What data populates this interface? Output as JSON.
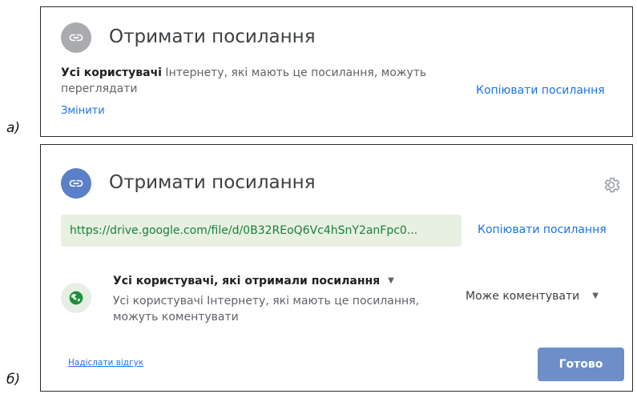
{
  "labels": {
    "a": "a)",
    "b": "б)"
  },
  "panel_a": {
    "title": "Отримати посилання",
    "desc_bold": "Усі користувачі",
    "desc_rest": " Інтернету, які мають це посилання, можуть",
    "desc_line2": "переглядати",
    "change_link": "Змінити",
    "copy_link": "Копіювати посилання",
    "icon": "link-icon"
  },
  "panel_b": {
    "title": "Отримати посилання",
    "url": "https://drive.google.com/file/d/0B32REoQ6Vc4hSnY2anFpc0...",
    "copy_link": "Копіювати посилання",
    "scope_title": "Усі користувачі, які отримали посилання",
    "scope_desc_line1": "Усі користувачі Інтернету, які мають це посилання,",
    "scope_desc_line2": "можуть коментувати",
    "role": "Може коментувати",
    "feedback": "Надіслати відгук",
    "done": "Готово",
    "icons": [
      "link-icon",
      "gear-icon",
      "globe-icon",
      "caret-down-icon"
    ]
  },
  "colors": {
    "accent": "#1a73e8",
    "link_green": "#188038",
    "button": "#6d8ec8",
    "icon_grey": "#a9abae",
    "icon_blue": "#5b7fc9"
  }
}
